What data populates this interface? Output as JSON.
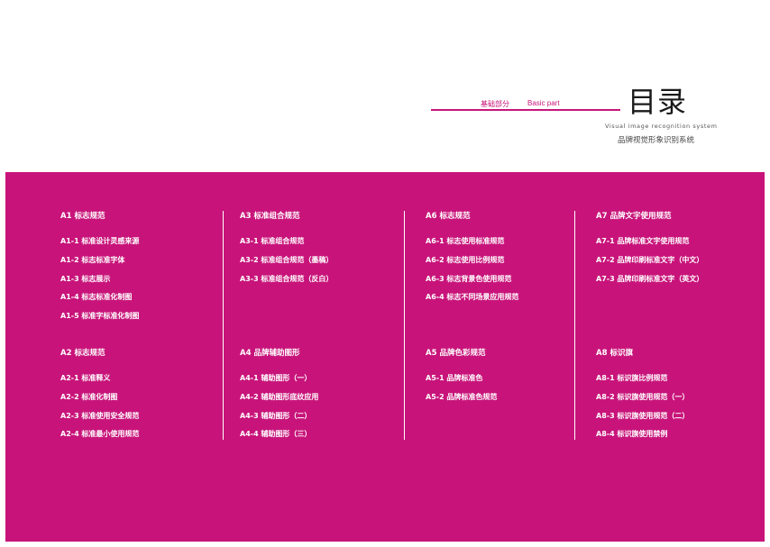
{
  "header": {
    "section_cn": "基础部分",
    "section_en": "Basic part",
    "title": "目录",
    "subtitle_en": "Visual image recognition system",
    "subtitle_cn": "品牌视觉形象识别系统"
  },
  "colors": {
    "accent": "#c8147a",
    "panel_text": "#ffffff"
  },
  "columns": [
    {
      "groups": [
        {
          "title": "A1 标志规范",
          "items": [
            "A1-1 标准设计灵感来源",
            "A1-2 标志标准字体",
            "A1-3 标志展示",
            "A1-4 标志标准化制图",
            "A1-5 标准字标准化制图"
          ]
        },
        {
          "title": "A2 标志规范",
          "items": [
            "A2-1 标准释义",
            "A2-2 标准化制图",
            "A2-3 标准使用安全规范",
            "A2-4 标准最小使用规范"
          ]
        }
      ]
    },
    {
      "groups": [
        {
          "title": "A3 标准组合规范",
          "items": [
            "A3-1 标准组合规范",
            "A3-2 标准组合规范（墨稿）",
            "A3-3 标准组合规范（反白）"
          ]
        },
        {
          "title": "A4 品牌辅助图形",
          "items": [
            "A4-1 辅助图形（一）",
            "A4-2 辅助图形底纹应用",
            "A4-3 辅助图形（二）",
            "A4-4 辅助图形（三）"
          ]
        }
      ]
    },
    {
      "groups": [
        {
          "title": "A6 标志规范",
          "items": [
            "A6-1 标志使用标准规范",
            "A6-2 标志使用比例规范",
            "A6-3 标志背景色使用规范",
            "A6-4 标志不同场景应用规范"
          ]
        },
        {
          "title": "A5 品牌色彩规范",
          "items": [
            "A5-1 品牌标准色",
            "A5-2 品牌标准色规范"
          ]
        }
      ]
    },
    {
      "groups": [
        {
          "title": "A7 品牌文字使用规范",
          "items": [
            "A7-1 品牌标准文字使用规范",
            "A7-2 品牌印刷标准文字（中文）",
            "A7-3 品牌印刷标准文字（英文）"
          ]
        },
        {
          "title": "A8 标识旗",
          "items": [
            "A8-1 标识旗比例规范",
            "A8-2 标识旗使用规范（一）",
            "A8-3 标识旗使用规范（二）",
            "A8-4 标识旗使用禁例"
          ]
        }
      ]
    }
  ]
}
